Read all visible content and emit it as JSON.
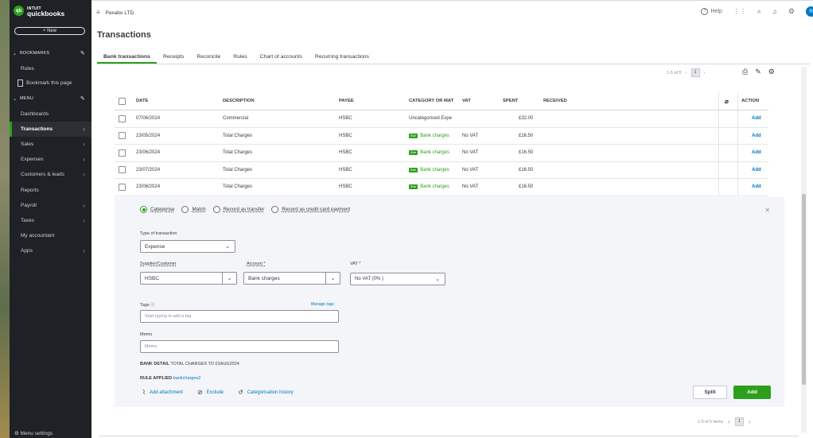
{
  "sidebar": {
    "logo": {
      "brand_small": "INTUIT",
      "brand": "quickbooks",
      "badge": "qb"
    },
    "new_label": "+ New",
    "bookmarks_label": "BOOKMARKS",
    "rules_label": "Rules",
    "bookmark_page_label": "Bookmark this page",
    "menu_label": "MENU",
    "items": [
      {
        "label": "Dashboards",
        "arrow": false
      },
      {
        "label": "Transactions",
        "arrow": true,
        "active": true
      },
      {
        "label": "Sales",
        "arrow": true
      },
      {
        "label": "Expenses",
        "arrow": true
      },
      {
        "label": "Customers & leads",
        "arrow": true
      },
      {
        "label": "Reports",
        "arrow": false
      },
      {
        "label": "Payroll",
        "arrow": true
      },
      {
        "label": "Taxes",
        "arrow": true
      },
      {
        "label": "My accountant",
        "arrow": false
      },
      {
        "label": "Apps",
        "arrow": true
      }
    ],
    "menu_settings_label": "Menu settings"
  },
  "topbar": {
    "company": "Pexabo LTD",
    "help_label": "Help",
    "avatar_initial": "R"
  },
  "page": {
    "title": "Transactions",
    "tabs": [
      "Bank transactions",
      "Receipts",
      "Reconcile",
      "Rules",
      "Chart of accounts",
      "Recurring transactions"
    ],
    "pager_top": {
      "range": "1-5 of 5",
      "page": "1"
    }
  },
  "table": {
    "headers": {
      "date": "DATE",
      "description": "DESCRIPTION",
      "payee": "PAYEE",
      "category": "CATEGORY OR MAT",
      "vat": "VAT",
      "spent": "SPENT",
      "received": "RECEIVED",
      "action": "ACTION"
    },
    "rows": [
      {
        "date": "07/06/2024",
        "description": "Commercial",
        "payee": "HSBC",
        "rule": "",
        "category": "Uncategorised Expe",
        "vat": "",
        "spent": "£32.00",
        "action": "Add"
      },
      {
        "date": "23/05/2024",
        "description": "Total Charges",
        "payee": "HSBC",
        "rule": "Rule",
        "category": "Bank charges",
        "vat": "No VAT",
        "spent": "£16.50",
        "action": "Add"
      },
      {
        "date": "23/06/2024",
        "description": "Total Charges",
        "payee": "HSBC",
        "rule": "Rule",
        "category": "Bank charges",
        "vat": "No VAT",
        "spent": "£16.50",
        "action": "Add"
      },
      {
        "date": "23/07/2024",
        "description": "Total Charges",
        "payee": "HSBC",
        "rule": "Rule",
        "category": "Bank charges",
        "vat": "No VAT",
        "spent": "£16.50",
        "action": "Add"
      },
      {
        "date": "23/08/2024",
        "description": "Total Charges",
        "payee": "HSBC",
        "rule": "Rule",
        "category": "Bank charges",
        "vat": "No VAT",
        "spent": "£16.50",
        "action": "Add"
      }
    ]
  },
  "detail": {
    "radios": [
      "Categorise",
      "Match",
      "Record as transfer",
      "Record as credit card payment"
    ],
    "type_label": "Type of transaction",
    "type_value": "Expense",
    "supplier_label": "Supplier/Customer",
    "supplier_value": "HSBC",
    "account_label": "Account *",
    "account_value": "Bank charges",
    "vat_label": "VAT *",
    "vat_value": "No VAT (0% )",
    "tags_label": "Tags",
    "manage_tags": "Manage tags",
    "tags_placeholder": "Start typing to add a tag",
    "memo_label": "Memo",
    "memo_placeholder": "Memo",
    "bank_detail_label": "BANK DETAIL",
    "bank_detail_value": "TOTAL CHARGES TO 01AUG2024",
    "rule_applied_label": "RULE APPLIED",
    "rule_applied_value": "bankcharges2",
    "add_attachment": "Add attachment",
    "exclude": "Exclude",
    "categorisation_history": "Categorisation history",
    "split_label": "Split",
    "add_label": "Add"
  },
  "pager_bottom": {
    "range": "1-5 of 5 items",
    "page": "1"
  },
  "colors": {
    "brand_green": "#2ca01c",
    "link_blue": "#0077c5",
    "sidebar_bg": "#1e2125"
  }
}
